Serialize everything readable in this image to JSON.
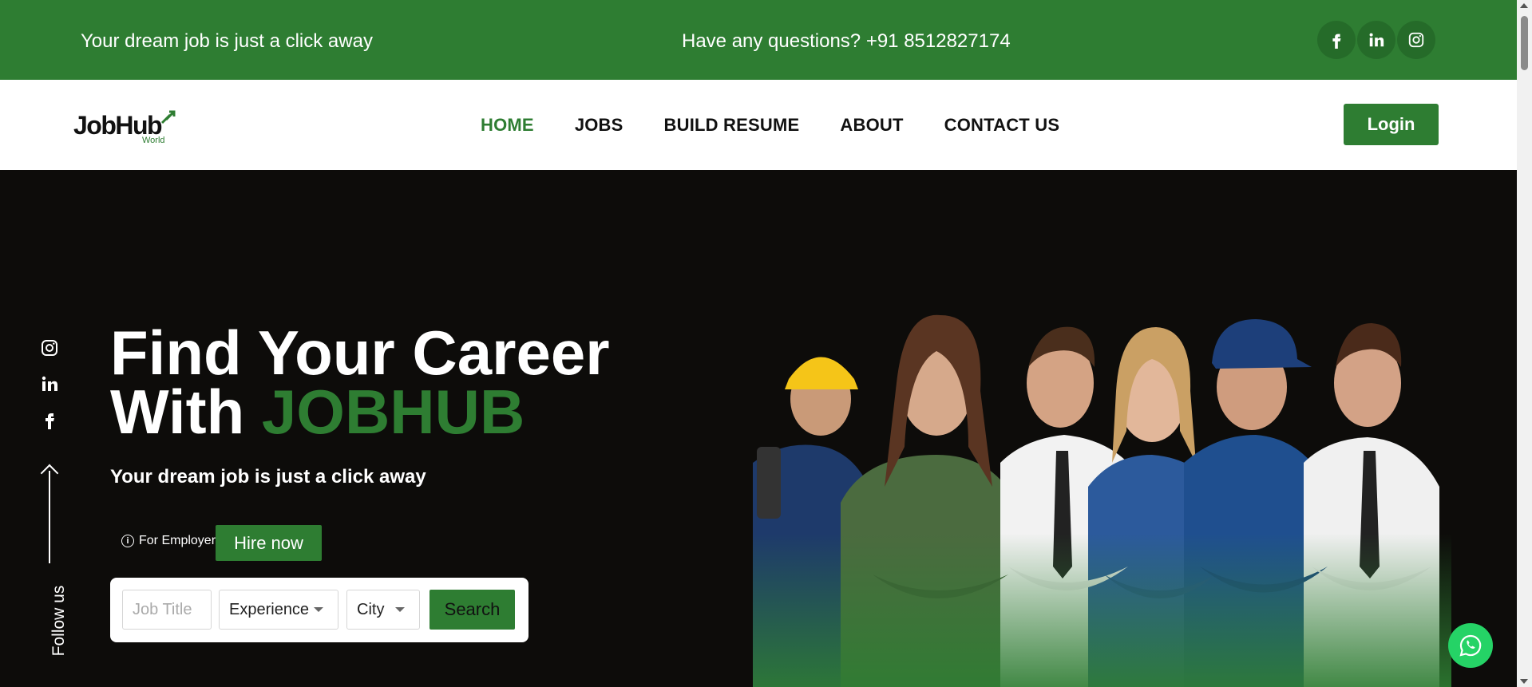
{
  "topbar": {
    "tagline": "Your dream job is just a click away",
    "phone": "Have any questions? +91 8512827174",
    "socials": [
      "facebook-icon",
      "linkedin-icon",
      "instagram-icon"
    ]
  },
  "header": {
    "logo_text": "JobHub",
    "logo_sub": "World",
    "nav": [
      "HOME",
      "JOBS",
      "BUILD RESUME",
      "ABOUT",
      "CONTACT US"
    ],
    "active_nav": "HOME",
    "login_label": "Login"
  },
  "hero": {
    "title_line1": "Find Your Career",
    "title_line2_prefix": "With ",
    "title_brand": "JOBHUB",
    "subtitle": "Your dream job is just a click away",
    "employer_label": "For Employer",
    "hire_label": "Hire now",
    "follow_label": "Follow us",
    "side_socials": [
      "instagram-icon",
      "linkedin-icon",
      "facebook-icon"
    ]
  },
  "search": {
    "job_title_placeholder": "Job Title",
    "experience_value": "Experience",
    "city_value": "City",
    "search_label": "Search"
  },
  "colors": {
    "brand_green": "#2e7d32",
    "hero_bg": "#0d0c0a",
    "whatsapp": "#25d366"
  }
}
